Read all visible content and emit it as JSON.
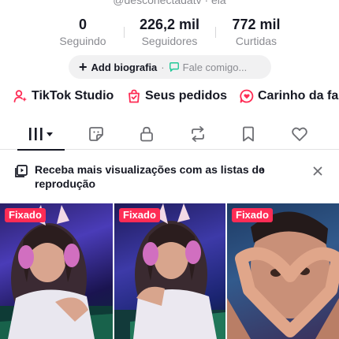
{
  "profile": {
    "handle_partial": "@desconectadatv · ela"
  },
  "stats": {
    "following": {
      "value": "0",
      "label": "Seguindo"
    },
    "followers": {
      "value": "226,2 mil",
      "label": "Seguidores"
    },
    "likes": {
      "value": "772 mil",
      "label": "Curtidas"
    }
  },
  "bio": {
    "add_label": "Add biografia",
    "separator": "·",
    "message_label": "Fale comigo..."
  },
  "shortcuts": [
    {
      "label": "TikTok Studio",
      "icon": "studio-person-icon"
    },
    {
      "label": "Seus pedidos",
      "icon": "shopping-bag-icon"
    },
    {
      "label": "Carinho da fa",
      "icon": "heart-bubble-icon"
    }
  ],
  "tabs": [
    {
      "icon": "grid-icon",
      "active": true
    },
    {
      "icon": "sticker-icon"
    },
    {
      "icon": "lock-icon"
    },
    {
      "icon": "repost-icon"
    },
    {
      "icon": "bookmark-icon"
    },
    {
      "icon": "heart-icon"
    }
  ],
  "banner": {
    "text": "Receba mais visualizações com as listas de reprodução",
    "chevron": "›"
  },
  "videos": [
    {
      "pinned_label": "Fixado"
    },
    {
      "pinned_label": "Fixado"
    },
    {
      "pinned_label": "Fixado"
    }
  ],
  "colors": {
    "accent": "#fe2c55",
    "text_primary": "#161823",
    "text_secondary": "#8a8b91",
    "pill_bg": "#f1f1f2",
    "chat_icon": "#20c997"
  }
}
